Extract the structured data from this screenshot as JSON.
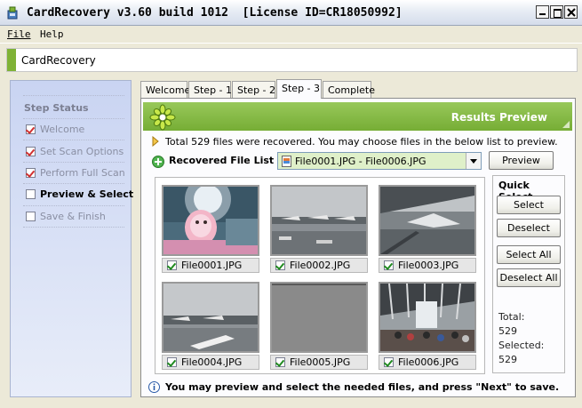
{
  "window": {
    "title": "CardRecovery v3.60 build 1012  [License ID=CR18050992]"
  },
  "menu": {
    "file": "File",
    "help": "Help"
  },
  "header": {
    "title": "CardRecovery",
    "accent_color": "#7fb236"
  },
  "sidebar": {
    "heading": "Step Status",
    "steps": [
      {
        "label": "Welcome",
        "checked": true
      },
      {
        "label": "Set Scan Options",
        "checked": true
      },
      {
        "label": "Perform Full Scan",
        "checked": true
      },
      {
        "label": "Preview & Select",
        "checked": false,
        "active": true
      },
      {
        "label": "Save & Finish",
        "checked": false
      }
    ]
  },
  "tabs": [
    {
      "label": "Welcome"
    },
    {
      "label": "Step - 1"
    },
    {
      "label": "Step - 2"
    },
    {
      "label": "Step - 3",
      "active": true
    },
    {
      "label": "Complete"
    }
  ],
  "panel": {
    "title": "Results Preview",
    "info": "Total 529 files were recovered. You may choose files in the below list to preview.",
    "list_label": "Recovered File List",
    "file_range": "File0001.JPG - File0006.JPG",
    "preview_button": "Preview",
    "thumbnails": [
      {
        "name": "File0001.JPG",
        "checked": true
      },
      {
        "name": "File0002.JPG",
        "checked": true
      },
      {
        "name": "File0003.JPG",
        "checked": true
      },
      {
        "name": "File0004.JPG",
        "checked": true
      },
      {
        "name": "File0005.JPG",
        "checked": true
      },
      {
        "name": "File0006.JPG",
        "checked": true
      }
    ],
    "quick_select": {
      "title": "Quick Select",
      "select": "Select",
      "deselect": "Deselect",
      "select_all": "Select All",
      "deselect_all": "Deselect All",
      "total_label": "Total:",
      "total_value": "529",
      "selected_label": "Selected:",
      "selected_value": "529"
    },
    "bottom_note": "You may preview and select the needed files, and press \"Next\" to save."
  }
}
